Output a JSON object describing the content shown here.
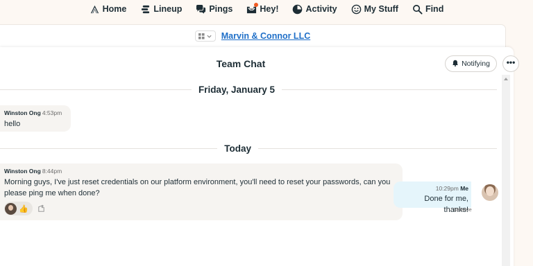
{
  "nav": {
    "home": "Home",
    "lineup": "Lineup",
    "pings": "Pings",
    "hey": "Hey!",
    "activity": "Activity",
    "mystuff": "My Stuff",
    "find": "Find"
  },
  "project": {
    "name": "Marvin & Connor LLC"
  },
  "chat": {
    "title": "Team Chat",
    "notify_label": "Notifying",
    "more_label": "•••",
    "dividers": [
      "Friday, January 5",
      "Today"
    ],
    "messages": [
      {
        "author": "Winston Ong",
        "time": "4:53pm",
        "text": "hello"
      },
      {
        "author": "Winston Ong",
        "time": "8:44pm",
        "text": "Morning guys, I've just reset credentials on our platform environment, you'll need to reset your passwords, can you please ping me when done?",
        "reaction_emoji": "👍"
      }
    ],
    "my_message": {
      "time": "10:29pm",
      "author": "Me",
      "text": "Done for me, thanks!",
      "status": "Delivered"
    }
  },
  "colors": {
    "accent_link": "#1f6fc8",
    "hey_dot": "#f05a22",
    "my_bubble": "#e5f5fb"
  }
}
